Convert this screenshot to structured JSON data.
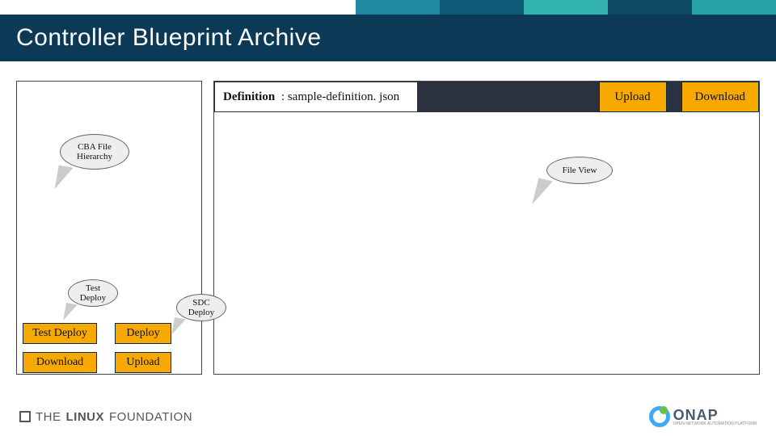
{
  "accent_color": "#f7a900",
  "header_bg": "#0c3a56",
  "title": "Controller Blueprint Archive",
  "definition": {
    "label": "Definition",
    "value": "sample-definition. json",
    "upload": "Upload",
    "download": "Download"
  },
  "callouts": {
    "cba": "CBA File Hierarchy",
    "fileview": "File View",
    "test": "Test Deploy",
    "sdc": "SDC Deploy"
  },
  "buttons": {
    "test_deploy": "Test Deploy",
    "deploy": "Deploy",
    "download": "Download",
    "upload": "Upload"
  },
  "footer": {
    "left_thin": "THE",
    "left_bold": "LINUX",
    "left_rest": "FOUNDATION",
    "right_brand": "ONAP",
    "right_sub": "OPEN NETWORK AUTOMATION PLATFORM"
  }
}
